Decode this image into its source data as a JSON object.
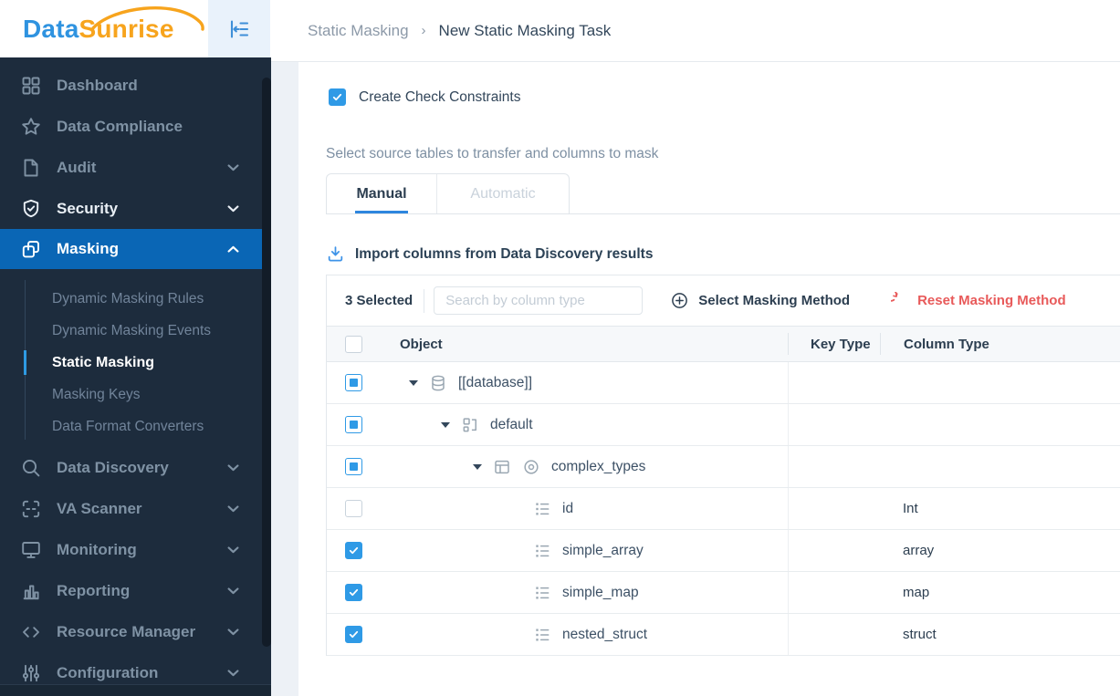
{
  "brand": {
    "name_part1": "Data",
    "name_part2": "Sunrise",
    "blue": "#2f93e0",
    "orange": "#f7a41d"
  },
  "topbar": {
    "collapse_icon": "collapse-sidebar-icon"
  },
  "breadcrumb": {
    "parent": "Static Masking",
    "separator": "›",
    "current": "New Static Masking Task"
  },
  "sidebar": {
    "items": [
      {
        "label": "Dashboard",
        "icon": "dashboard-grid-icon",
        "state": ""
      },
      {
        "label": "Data Compliance",
        "icon": "star-icon",
        "state": ""
      },
      {
        "label": "Audit",
        "icon": "audit-document-icon",
        "chevron": "down",
        "state": ""
      },
      {
        "label": "Security",
        "icon": "shield-check-icon",
        "chevron": "down",
        "state": "bright"
      },
      {
        "label": "Masking",
        "icon": "masking-copy-icon",
        "chevron": "up",
        "state": "active"
      },
      {
        "label": "Data Discovery",
        "icon": "search-icon",
        "chevron": "down",
        "state": ""
      },
      {
        "label": "VA Scanner",
        "icon": "scanner-icon",
        "chevron": "down",
        "state": ""
      },
      {
        "label": "Monitoring",
        "icon": "monitor-icon",
        "chevron": "down",
        "state": ""
      },
      {
        "label": "Reporting",
        "icon": "bar-chart-icon",
        "chevron": "down",
        "state": ""
      },
      {
        "label": "Resource Manager",
        "icon": "code-icon",
        "chevron": "down",
        "state": ""
      },
      {
        "label": "Configuration",
        "icon": "sliders-icon",
        "chevron": "down",
        "state": ""
      }
    ],
    "masking_submenu": [
      {
        "label": "Dynamic Masking Rules",
        "state": ""
      },
      {
        "label": "Dynamic Masking Events",
        "state": ""
      },
      {
        "label": "Static Masking",
        "state": "active"
      },
      {
        "label": "Masking Keys",
        "state": ""
      },
      {
        "label": "Data Format Converters",
        "state": ""
      }
    ]
  },
  "main": {
    "create_check": {
      "label": "Create Check Constraints",
      "state": "checked"
    },
    "section_label": "Select source tables to transfer and columns to mask",
    "tabs": [
      {
        "label": "Manual",
        "state": "active"
      },
      {
        "label": "Automatic",
        "state": ""
      }
    ],
    "import_link": {
      "label": "Import columns from Data Discovery results",
      "icon": "download-icon"
    },
    "toolbar": {
      "selected_count": "3 Selected",
      "search_placeholder": "Search by column type",
      "select_masking_method": {
        "label": "Select Masking Method",
        "icon": "circled-plus-icon"
      },
      "reset_masking_method": {
        "label": "Reset Masking Method",
        "icon": "reset-arrow-icon",
        "color": "#e85a5a"
      }
    },
    "table": {
      "header": {
        "object": "Object",
        "key_type": "Key Type",
        "column_type": "Column Type",
        "select_all_state": "unchecked"
      },
      "rows": [
        {
          "object": "[[database]]",
          "icon": "database-icon",
          "level": 0,
          "expanded": true,
          "checkbox": "indeterminate",
          "key_type": "",
          "column_type": ""
        },
        {
          "object": "default",
          "icon": "schema-icon",
          "level": 1,
          "expanded": true,
          "checkbox": "indeterminate",
          "key_type": "",
          "column_type": ""
        },
        {
          "object": "complex_types",
          "icon": "table-icon",
          "eye": "eye-icon",
          "level": 2,
          "expanded": true,
          "checkbox": "indeterminate",
          "key_type": "",
          "column_type": ""
        },
        {
          "object": "id",
          "icon": "column-icon",
          "level": 3,
          "checkbox": "unchecked",
          "key_type": "",
          "column_type": "Int"
        },
        {
          "object": "simple_array",
          "icon": "column-icon",
          "level": 3,
          "checkbox": "checked",
          "key_type": "",
          "column_type": "array"
        },
        {
          "object": "simple_map",
          "icon": "column-icon",
          "level": 3,
          "checkbox": "checked",
          "key_type": "",
          "column_type": "map"
        },
        {
          "object": "nested_struct",
          "icon": "column-icon",
          "level": 3,
          "checkbox": "checked",
          "key_type": "",
          "column_type": "struct"
        }
      ]
    }
  },
  "colors": {
    "sidebar_bg": "#1d2c3d",
    "sidebar_active": "#0a66b5",
    "accent_blue": "#2f9ae6",
    "tab_underline": "#2e86de",
    "danger_red": "#e85a5a"
  }
}
